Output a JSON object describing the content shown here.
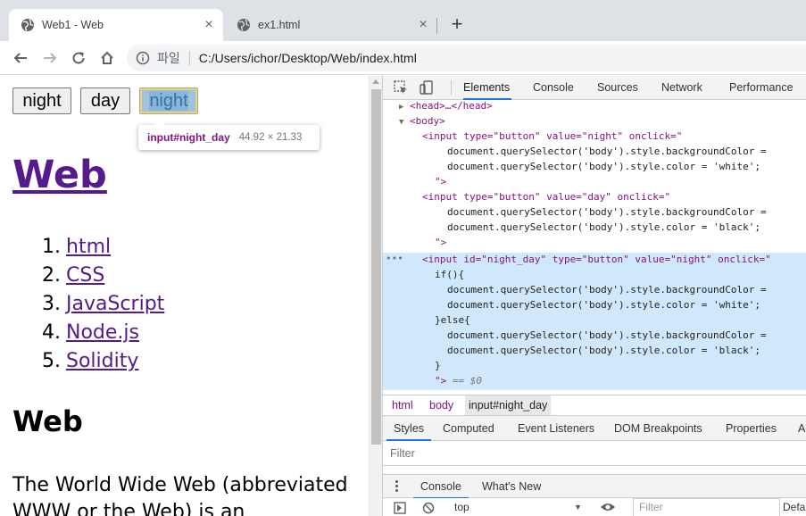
{
  "tabs": [
    {
      "title": "Web1 - Web",
      "active": true
    },
    {
      "title": "ex1.html",
      "active": false
    }
  ],
  "toolbar": {
    "scheme_label": "파일",
    "url": "C:/Users/ichor/Desktop/Web/index.html"
  },
  "page": {
    "buttons": [
      {
        "label": "night"
      },
      {
        "label": "day"
      },
      {
        "label": "night",
        "id": "night_day"
      }
    ],
    "tooltip": {
      "selector_tag": "input",
      "selector_id": "#night_day",
      "dimensions": "44.92 × 21.33"
    },
    "heading": "Web",
    "list": [
      {
        "num": "1.",
        "label": "html"
      },
      {
        "num": "2.",
        "label": "CSS"
      },
      {
        "num": "3.",
        "label": "JavaScript"
      },
      {
        "num": "4.",
        "label": "Node.js"
      },
      {
        "num": "5.",
        "label": "Solidity"
      }
    ],
    "subheading": "Web",
    "paragraph_line1": "The World Wide Web (abbreviated",
    "paragraph_line2": "WWW or the Web) is an"
  },
  "devtools": {
    "tabs": [
      "Elements",
      "Console",
      "Sources",
      "Network",
      "Performance"
    ],
    "active_tab": "Elements",
    "dom_lines": [
      "<head>…</head>",
      "<body>",
      "<input type=\"button\" value=\"night\" onclick=\"",
      "document.querySelector('body').style.backgroundColor =",
      "document.querySelector('body').style.color = 'white';",
      "\">",
      "<input type=\"button\" value=\"day\" onclick=\"",
      "document.querySelector('body').style.backgroundColor =",
      "document.querySelector('body').style.color = 'black';",
      "\">",
      "<input id=\"night_day\" type=\"button\" value=\"night\" onclick=\"",
      "if(){",
      "document.querySelector('body').style.backgroundColor =",
      "document.querySelector('body').style.color = 'white';",
      "}else{",
      "document.querySelector('body').style.backgroundColor =",
      "document.querySelector('body').style.color = 'black';",
      "}",
      "\">",
      "== $0"
    ],
    "breadcrumbs": [
      "html",
      "body",
      "input#night_day"
    ],
    "styles_tabs": [
      "Styles",
      "Computed",
      "Event Listeners",
      "DOM Breakpoints",
      "Properties",
      "Ac"
    ],
    "filter_placeholder": "Filter",
    "drawer_tabs": [
      "Console",
      "What's New"
    ],
    "console_context": "top",
    "console_filter_placeholder": "Filter",
    "console_levels": "Defa"
  },
  "colors": {
    "accent": "#1a73e8",
    "link_visited": "#551a8b",
    "dom_tag": "#881280",
    "dom_attr": "#994500",
    "dom_value": "#1a1aa6",
    "selection": "#cfe8fc"
  }
}
